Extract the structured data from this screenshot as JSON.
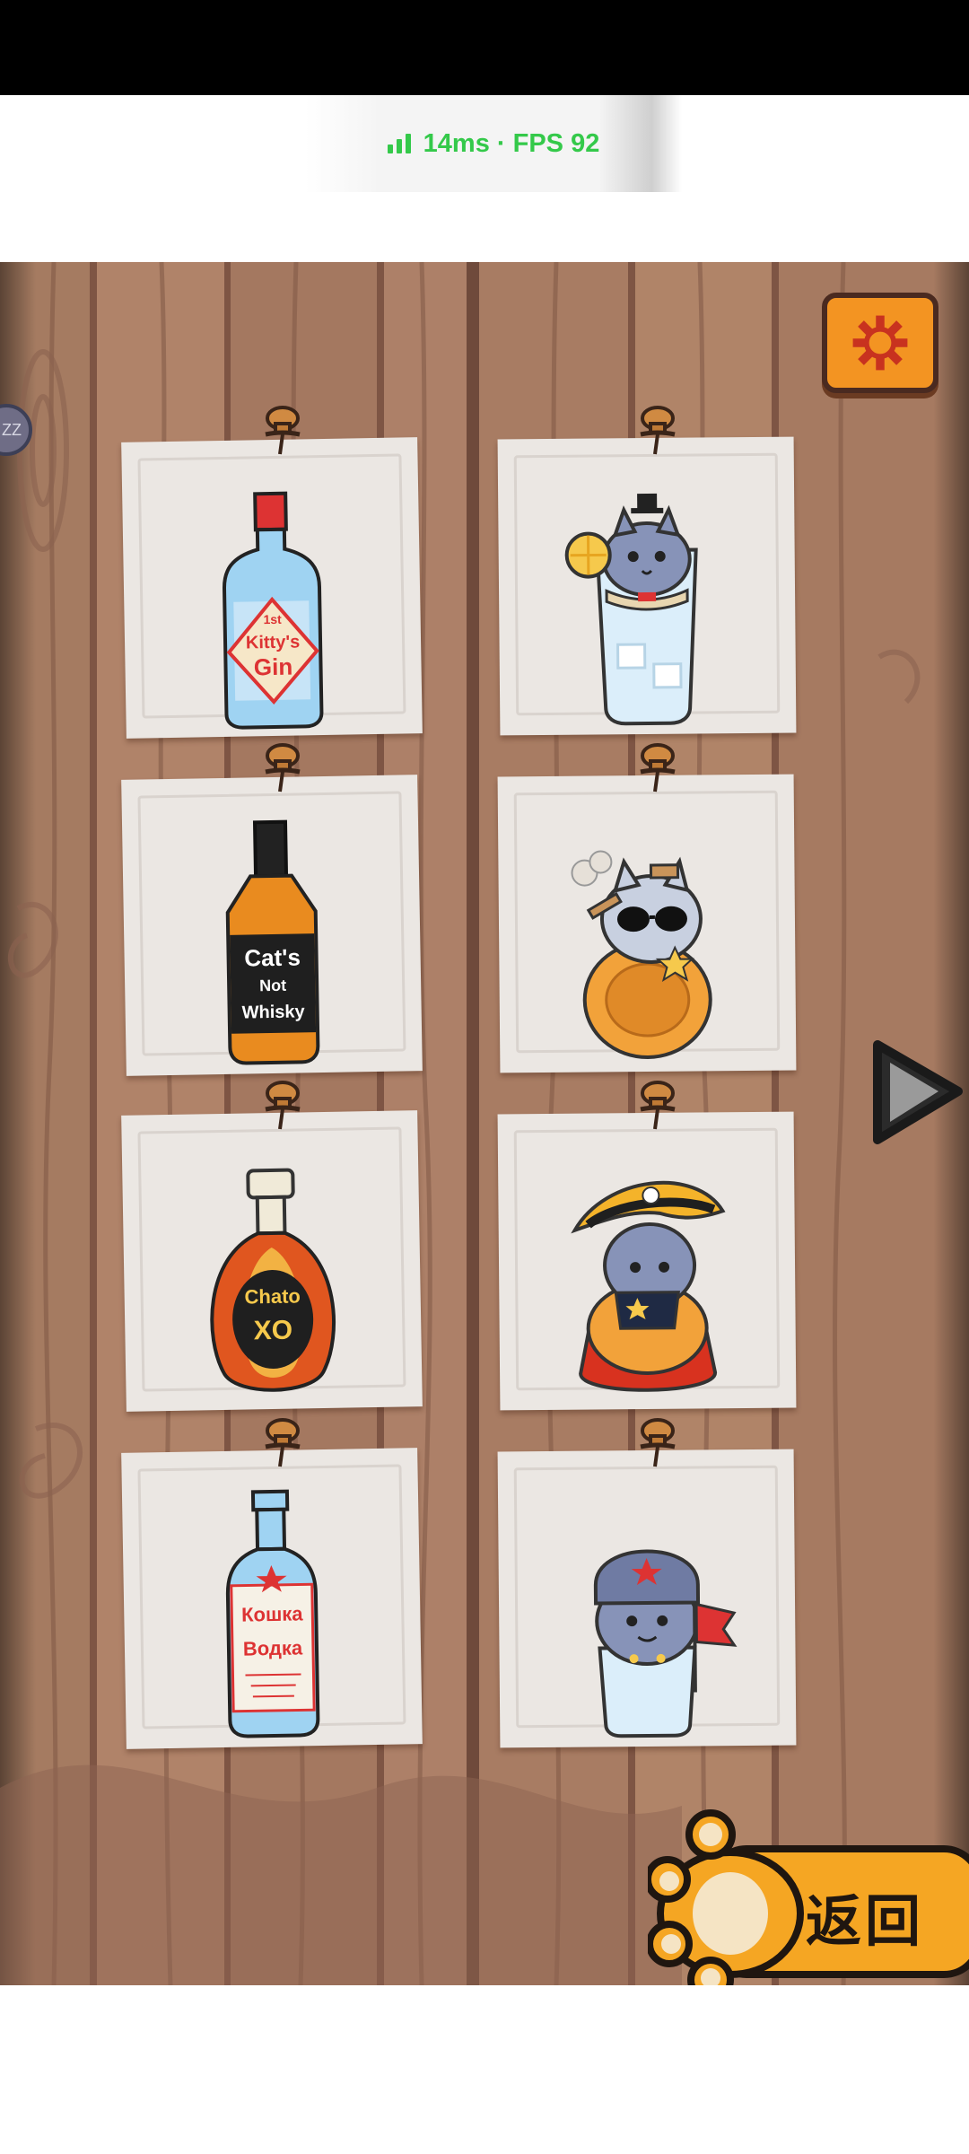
{
  "status": {
    "latency": "14ms",
    "fps_text": "FPS 92",
    "separator": "·"
  },
  "side_badge": "ZZ",
  "settings": {
    "icon": "gear-icon",
    "color": "#f39422"
  },
  "cards": [
    {
      "item": "gin-bottle",
      "label": "Kitty's Gin",
      "top_text": "1st",
      "brand": "Kitty's",
      "kind": "Gin"
    },
    {
      "item": "cat-in-gin-glass",
      "label": "cat in glass"
    },
    {
      "item": "whisky-bottle",
      "label": "Cat's Not Whisky",
      "line1": "Cat's",
      "line2": "Not",
      "line3": "Whisky"
    },
    {
      "item": "cat-in-whisky-glass",
      "label": "cool cat with cigar"
    },
    {
      "item": "cognac-bottle",
      "label": "Chato XO",
      "line1": "Chato",
      "line2": "XO"
    },
    {
      "item": "cat-in-cognac-glass",
      "label": "cat with bicorne hat"
    },
    {
      "item": "vodka-bottle",
      "label": "Кошка Водка",
      "line1": "Кошка",
      "line2": "Водка"
    },
    {
      "item": "cat-in-vodka-glass",
      "label": "cat with ushanka and flag"
    }
  ],
  "next_arrow": "play-arrow-icon",
  "back_button": {
    "label": "返回",
    "icon": "paw-icon",
    "color": "#f5a623"
  },
  "colors": {
    "accent": "#f39422",
    "status_green": "#34c94a",
    "wood": "#a57b61",
    "paper": "#ebe7e3"
  }
}
